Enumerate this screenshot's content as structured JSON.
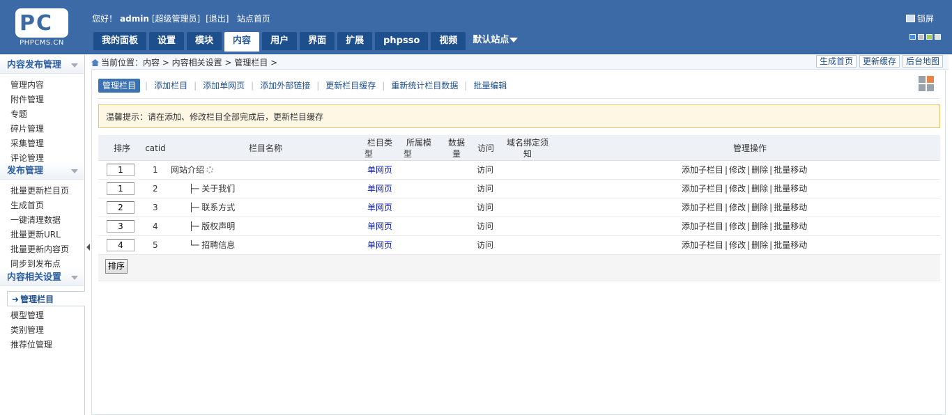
{
  "header": {
    "logo_text": "PC",
    "logo_sub": "PHPCMS.CN",
    "greeting": "您好！",
    "username": "admin",
    "role": "[超级管理员]",
    "logout": "[退出]",
    "site_home": "站点首页",
    "lock": "锁屏",
    "tabs": [
      "我的面板",
      "设置",
      "模块",
      "内容",
      "用户",
      "界面",
      "扩展",
      "phpsso",
      "视频"
    ],
    "active_tab": "内容",
    "site_selector": "默认站点",
    "skin_colors": [
      "#4a8fd6",
      "#bfbfbf",
      "#a6d25a",
      "#e0e0e0"
    ]
  },
  "sidebar": {
    "sections": [
      {
        "title": "内容发布管理",
        "items": [
          "管理内容",
          "附件管理",
          "专题",
          "碎片管理",
          "采集管理",
          "评论管理"
        ]
      },
      {
        "title": "发布管理",
        "items": [
          "批量更新栏目页",
          "生成首页",
          "一键清理数据",
          "批量更新URL",
          "批量更新内容页",
          "同步到发布点"
        ]
      },
      {
        "title": "内容相关设置",
        "active": "管理栏目",
        "items": [
          "模型管理",
          "类别管理",
          "推荐位管理"
        ]
      }
    ]
  },
  "breadcrumb": {
    "text": "当前位置：内容 > 内容相关设置 > 管理栏目 >",
    "buttons": [
      "生成首页",
      "更新缓存",
      "后台地图"
    ]
  },
  "subnav": {
    "items": [
      "管理栏目",
      "添加栏目",
      "添加单网页",
      "添加外部链接",
      "更新栏目缓存",
      "重新统计栏目数据",
      "批量编辑"
    ],
    "active": "管理栏目"
  },
  "tip": "温馨提示：请在添加、修改栏目全部完成后，更新栏目缓存",
  "table": {
    "headers": {
      "order": "排序",
      "catid": "catid",
      "name": "栏目名称",
      "type_1": "栏目类",
      "type_2": "型",
      "model_1": "所属模",
      "model_2": "型",
      "count_1": "数据",
      "count_2": "量",
      "visit": "访问",
      "domain_1": "域名绑定须",
      "domain_2": "知",
      "ops": "管理操作"
    },
    "rows": [
      {
        "order": "1",
        "catid": "1",
        "name": "网站介绍",
        "prefix": "",
        "type": "单网页",
        "visit": "访问"
      },
      {
        "order": "1",
        "catid": "2",
        "name": "关于我们",
        "prefix": "├─ ",
        "type": "单网页",
        "visit": "访问"
      },
      {
        "order": "2",
        "catid": "3",
        "name": "联系方式",
        "prefix": "├─ ",
        "type": "单网页",
        "visit": "访问"
      },
      {
        "order": "3",
        "catid": "4",
        "name": "版权声明",
        "prefix": "├─ ",
        "type": "单网页",
        "visit": "访问"
      },
      {
        "order": "4",
        "catid": "5",
        "name": "招聘信息",
        "prefix": "└─ ",
        "type": "单网页",
        "visit": "访问"
      }
    ],
    "ops": [
      "添加子栏目",
      "修改",
      "删除",
      "批量移动"
    ],
    "sort_button": "排序"
  }
}
